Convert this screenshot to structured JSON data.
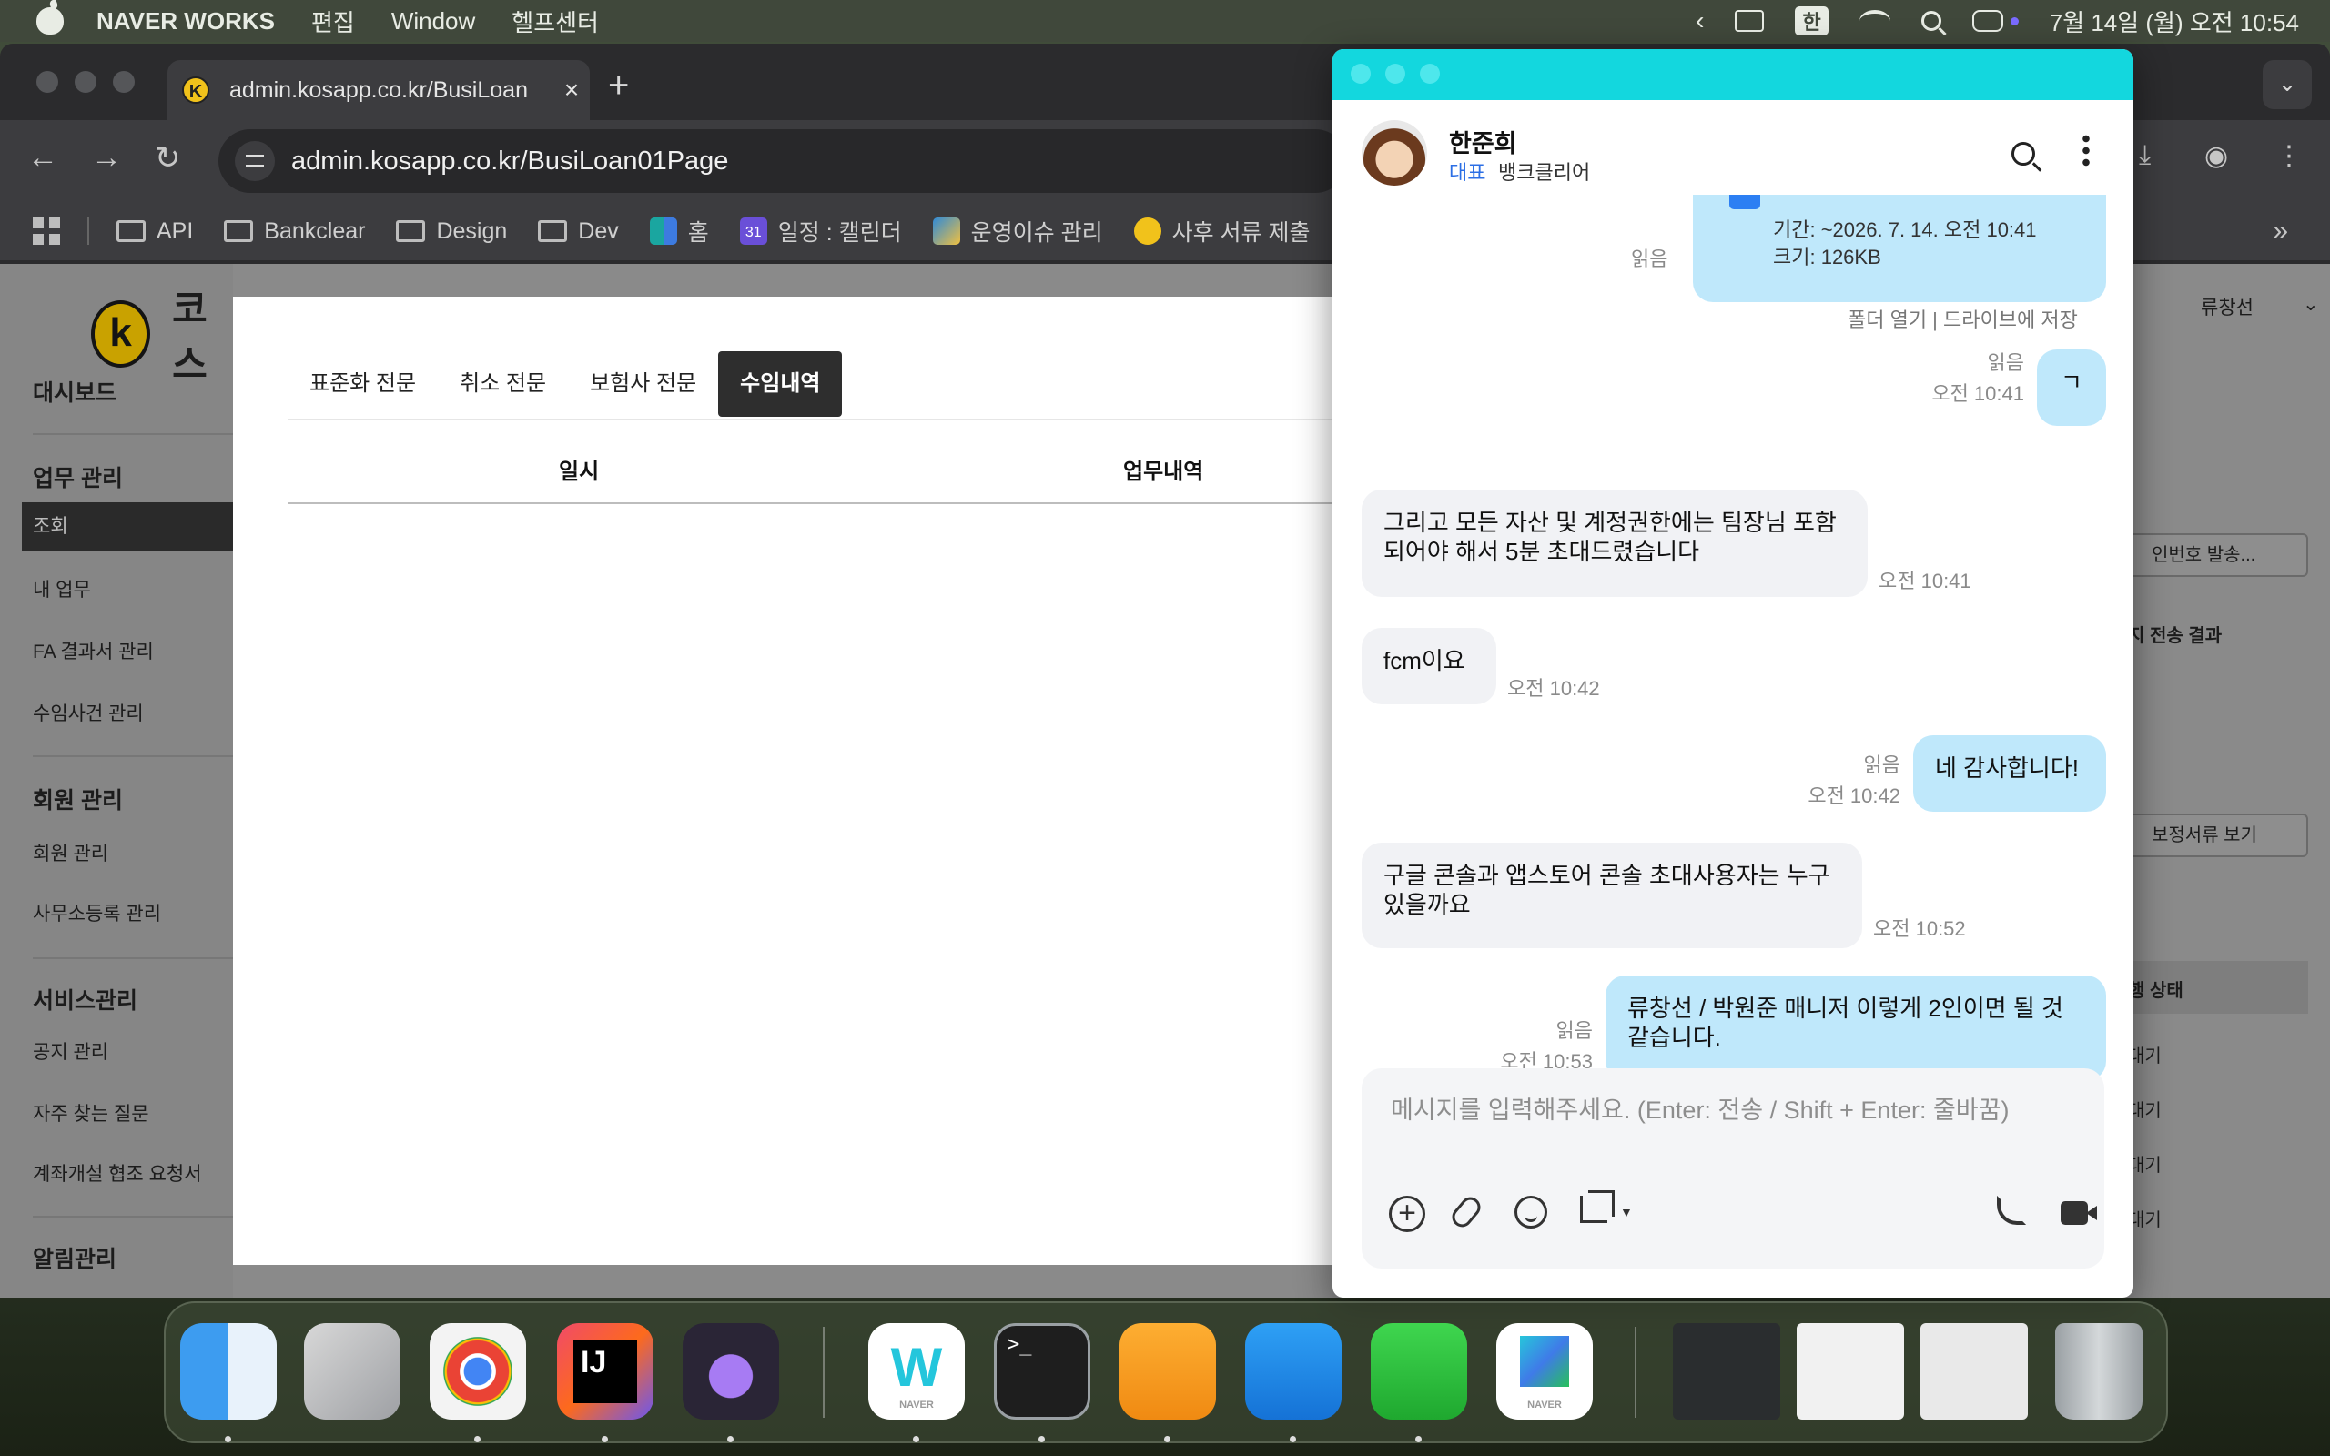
{
  "menubar": {
    "app_name": "NAVER WORKS",
    "menus": [
      "편집",
      "Window",
      "헬프센터"
    ],
    "ime": "한",
    "clock": "7월 14일 (월) 오전 10:54"
  },
  "browser": {
    "tab_title": "admin.kosapp.co.kr/BusiLoan",
    "tab_favicon": "K",
    "url": "admin.kosapp.co.kr/BusiLoan01Page",
    "bookmarks": [
      "API",
      "Bankclear",
      "Design",
      "Dev",
      "홈",
      "일정 : 캘린더",
      "운영이슈 관리",
      "사후 서류 제출"
    ],
    "calendar_day": "31"
  },
  "admin": {
    "logo_letter": "k",
    "logo_text": "코스",
    "sidebar": {
      "dashboard": "대시보드",
      "sections": [
        {
          "title": "업무 관리",
          "items": [
            "조회",
            "내 업무",
            "FA 결과서 관리",
            "수임사건 관리"
          ]
        },
        {
          "title": "회원 관리",
          "items": [
            "회원 관리",
            "사무소등록 관리"
          ]
        },
        {
          "title": "서비스관리",
          "items": [
            "공지 관리",
            "자주 찾는 질문",
            "계좌개설 협조 요청서"
          ]
        },
        {
          "title": "알림관리",
          "items": []
        }
      ]
    },
    "modal": {
      "tabs": [
        "표준화 전문",
        "취소 전문",
        "보험사 전문",
        "수임내역"
      ],
      "active_tab": "수임내역",
      "columns": [
        "일시",
        "업무내역"
      ]
    },
    "right": {
      "user": "류창선",
      "btn1": "인번호 발송...",
      "heading": "지 전송 결과",
      "btn2": "보정서류 보기",
      "band_label": "행 상태",
      "rows": [
        "대기",
        "대기",
        "대기",
        "대기"
      ]
    }
  },
  "chat": {
    "contact_name": "한준희",
    "contact_role": "대표",
    "contact_org": "뱅크클리어",
    "file": {
      "period": "기간: ~2026. 7. 14. 오전 10:41",
      "size": "크기: 126KB",
      "read": "읽음",
      "actions": "폴더 열기  |  드라이브에 저장"
    },
    "messages": [
      {
        "dir": "out",
        "text": "ㄱ",
        "read": "읽음",
        "time": "오전 10:41"
      },
      {
        "dir": "in",
        "text": "그리고 모든 자산 및 계정권한에는 팀장님 포함되어야 해서 5분 초대드렸습니다",
        "time": "오전 10:41"
      },
      {
        "dir": "in",
        "text": "fcm이요",
        "time": "오전 10:42"
      },
      {
        "dir": "out",
        "text": "네 감사합니다!",
        "read": "읽음",
        "time": "오전 10:42"
      },
      {
        "dir": "in",
        "text": "구글 콘솔과 앱스토어 콘솔 초대사용자는 누구있을까요",
        "time": "오전 10:52"
      },
      {
        "dir": "out",
        "text": "류창선 / 박원준 매니저 이렇게 2인이면 될 것 같습니다.",
        "read": "읽음",
        "time": "오전 10:53"
      }
    ],
    "more": "• • •",
    "input_placeholder": "메시지를 입력해주세요. (Enter: 전송 / Shift + Enter: 줄바꿈)"
  },
  "dock": {
    "apps": [
      "Finder",
      "Launchpad",
      "Chrome",
      "IntelliJ IDEA",
      "Obsidian",
      "NAVER WORKS",
      "Terminal",
      "Pages",
      "Keynote",
      "Numbers",
      "NAVER"
    ],
    "intellij_label": "IJ",
    "works_letter": "W",
    "works_sub": "NAVER",
    "naver_sub": "NAVER",
    "terminal_prompt": ">_"
  },
  "colors": {
    "chat_titlebar": "#13d7de",
    "bubble_out": "#bfe8fb",
    "bubble_in": "#f1f2f5",
    "role_blue": "#2c6fe5"
  }
}
